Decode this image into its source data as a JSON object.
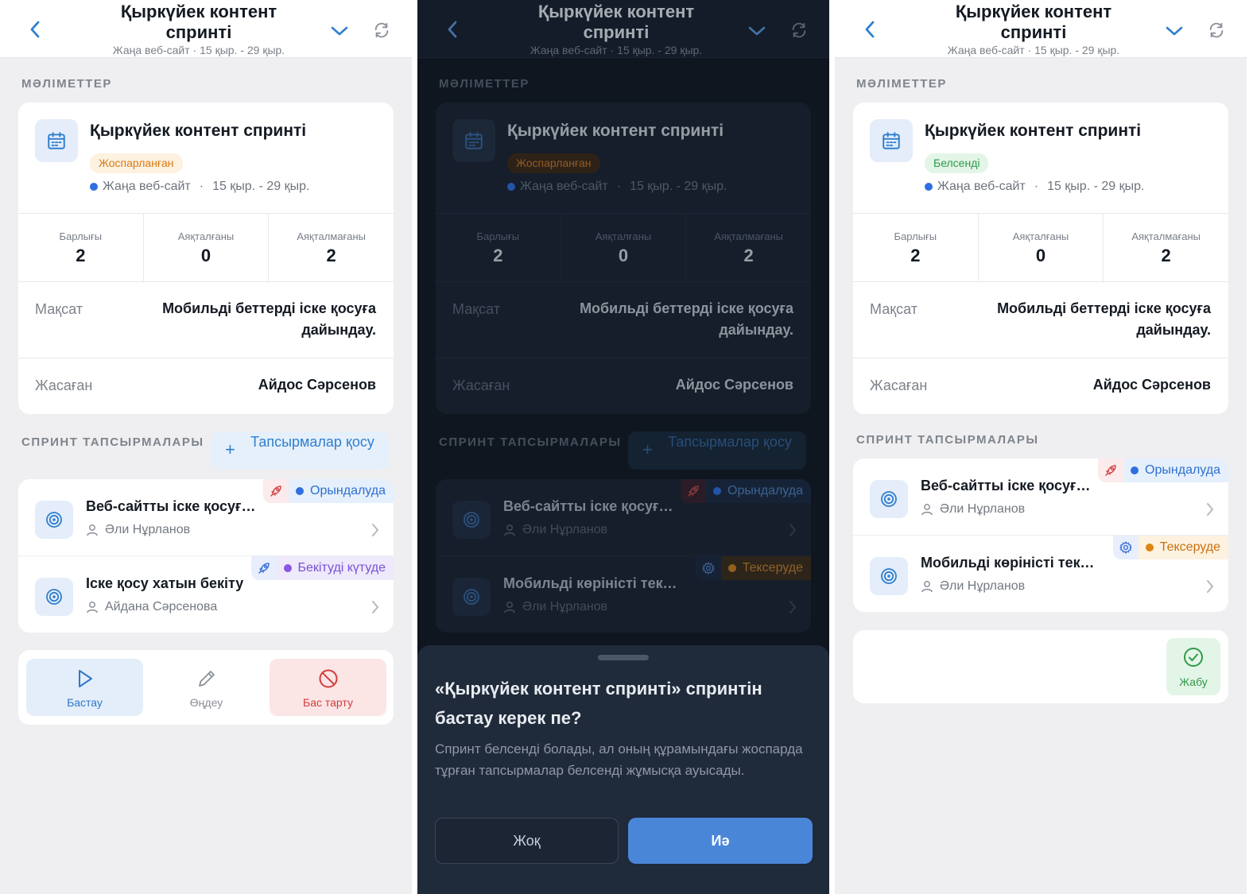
{
  "header": {
    "title": "Қыркүйек контент спринті",
    "subtitle": "Жаңа веб-сайт · 15 қыр. - 29 қыр."
  },
  "info": {
    "section_label": "МӘЛІМЕТТЕР",
    "sprint_title": "Қыркүйек контент спринті",
    "status_planned": "Жоспарланған",
    "status_active": "Белсенді",
    "project": "Жаңа веб-сайт",
    "dates": "15 қыр. - 29 қыр.",
    "meta_separator": "·",
    "stats": [
      {
        "label": "Барлығы",
        "value": "2"
      },
      {
        "label": "Аяқталғаны",
        "value": "0"
      },
      {
        "label": "Аяқталмағаны",
        "value": "2"
      }
    ],
    "goal_label": "Мақсат",
    "goal_value": "Мобильді беттерді іске қосуға дайындау.",
    "creator_label": "Жасаған",
    "creator_value": "Айдос Сәрсенов"
  },
  "tasks_section": {
    "label": "СПРИНТ ТАПСЫРМАЛАРЫ",
    "add_button": "Тапсырмалар қосу",
    "add_plus": "+"
  },
  "tasks_p1": [
    {
      "title": "Веб-сайтты іске қосуға дайындау",
      "assignee": "Әли Нұрланов",
      "status": "Орындалуда",
      "type_icon": "rocket-icon"
    },
    {
      "title": "Іске қосу хатын бекіту",
      "assignee": "Айдана Сәрсенова",
      "status": "Бекітуді күтуде",
      "type_icon": "rocket-icon"
    }
  ],
  "tasks_p2": [
    {
      "title": "Веб-сайтты іске қосуға дайындау",
      "assignee": "Әли Нұрланов",
      "status": "Орындалуда",
      "type_icon": "rocket-icon"
    },
    {
      "title": "Мобильді көріністі тексеру",
      "assignee": "Әли Нұрланов",
      "status": "Тексеруде",
      "type_icon": "gear-icon"
    }
  ],
  "actions": {
    "start": "Бастау",
    "edit": "Өңдеу",
    "cancel": "Бас тарту",
    "close": "Жабу"
  },
  "dialog": {
    "title": "«Қыркүйек контент спринті» спринтін бастау керек пе?",
    "body": "Спринт белсенді болады, ал оның құрамындағы жоспарда тұрған тапсырмалар белсенді жұмысқа ауысады.",
    "no": "Жоқ",
    "yes": "Иә"
  },
  "colors": {
    "accent": "#2f78c8",
    "planned": "#d97a17",
    "active": "#2f9a49",
    "in_progress": "#2f6fd0",
    "awaiting_approval": "#7a4fd6",
    "in_review": "#c8700f",
    "danger": "#d23d3d",
    "dark_background": "#121a25"
  }
}
